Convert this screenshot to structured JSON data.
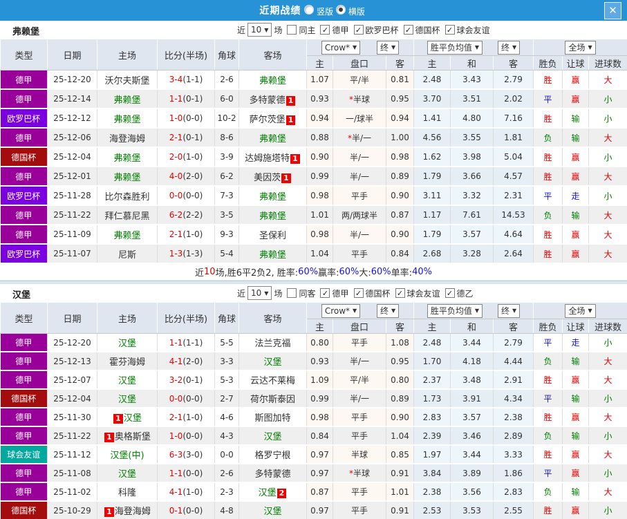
{
  "title_bar": {
    "title": "近期战绩",
    "radios": [
      {
        "label": "竖版",
        "selected": false
      },
      {
        "label": "横版",
        "selected": true
      }
    ],
    "close_icon": "✕"
  },
  "icons": {
    "check": "✓",
    "dropdown_arrow": "▼"
  },
  "colors": {
    "titlebar": "#2793D6",
    "type_colors": {
      "德甲": "#990099",
      "欧罗巴杯": "#7A00E0",
      "德国杯": "#A30D0D",
      "球会友谊": "#00A89E"
    },
    "result_colors": {
      "胜": "#E60000",
      "平": "#1414E6",
      "负": "#008000",
      "赢": "#E60000",
      "走": "#1414E6",
      "输": "#008000",
      "大": "#E60000",
      "小": "#008000"
    }
  },
  "table_headers": {
    "left": [
      "类型",
      "日期",
      "主场",
      "比分(半场)",
      "角球",
      "客场"
    ],
    "subs": [
      "主",
      "盘口",
      "客",
      "主",
      "和",
      "客",
      "胜负",
      "让球",
      "进球数"
    ],
    "control_groups": [
      [
        "Crow*",
        "终"
      ],
      [
        "胜平负均值",
        "终"
      ],
      [
        "全场"
      ]
    ]
  },
  "sections": [
    {
      "team": "弗赖堡",
      "filter": {
        "prefix": "近",
        "count": "10",
        "suffix": "场",
        "same": {
          "label": "同主",
          "checked": false
        },
        "leagues": [
          {
            "label": "德甲",
            "checked": true
          },
          {
            "label": "欧罗巴杯",
            "checked": true
          },
          {
            "label": "德国杯",
            "checked": true
          },
          {
            "label": "球会友谊",
            "checked": true
          }
        ]
      },
      "rows": [
        {
          "type": "德甲",
          "date": "25-12-20",
          "home": {
            "n": "沃尔夫斯堡"
          },
          "score": "3-4",
          "half": "1-1",
          "corner": "2-6",
          "away": {
            "n": "弗赖堡",
            "g": true
          },
          "o1": "1.07",
          "hcap": "平/半",
          "o2": "0.81",
          "avg": [
            "2.48",
            "3.43",
            "2.79"
          ],
          "res": [
            "胜",
            "赢",
            "大"
          ]
        },
        {
          "type": "德甲",
          "date": "25-12-14",
          "home": {
            "n": "弗赖堡",
            "g": true
          },
          "score": "1-1",
          "half": "0-1",
          "corner": "6-0",
          "away": {
            "n": "多特蒙德",
            "b": "1",
            "bp": "after"
          },
          "o1": "0.93",
          "hcap": "*半球",
          "o2": "0.95",
          "avg": [
            "3.70",
            "3.51",
            "2.02"
          ],
          "res": [
            "平",
            "赢",
            "小"
          ]
        },
        {
          "type": "欧罗巴杯",
          "date": "25-12-12",
          "home": {
            "n": "弗赖堡",
            "g": true
          },
          "score": "1-0",
          "half": "0-0",
          "corner": "10-2",
          "away": {
            "n": "萨尔茨堡",
            "b": "1",
            "bp": "after"
          },
          "o1": "0.94",
          "hcap": "一/球半",
          "o2": "0.94",
          "avg": [
            "1.41",
            "4.80",
            "7.16"
          ],
          "res": [
            "胜",
            "输",
            "小"
          ]
        },
        {
          "type": "德甲",
          "date": "25-12-06",
          "home": {
            "n": "海登海姆"
          },
          "score": "2-1",
          "half": "0-1",
          "corner": "8-6",
          "away": {
            "n": "弗赖堡",
            "g": true
          },
          "o1": "0.88",
          "hcap": "*半/一",
          "o2": "1.00",
          "avg": [
            "4.56",
            "3.55",
            "1.81"
          ],
          "res": [
            "负",
            "输",
            "大"
          ]
        },
        {
          "type": "德国杯",
          "date": "25-12-04",
          "home": {
            "n": "弗赖堡",
            "g": true
          },
          "score": "2-0",
          "half": "1-0",
          "corner": "3-9",
          "away": {
            "n": "达姆施塔特",
            "b": "1",
            "bp": "after"
          },
          "o1": "0.90",
          "hcap": "半/一",
          "o2": "0.98",
          "avg": [
            "1.62",
            "3.98",
            "5.04"
          ],
          "res": [
            "胜",
            "赢",
            "小"
          ]
        },
        {
          "type": "德甲",
          "date": "25-12-01",
          "home": {
            "n": "弗赖堡",
            "g": true
          },
          "score": "4-0",
          "half": "2-0",
          "corner": "6-2",
          "away": {
            "n": "美因茨",
            "b": "1",
            "bp": "after"
          },
          "o1": "0.99",
          "hcap": "半/一",
          "o2": "0.89",
          "avg": [
            "1.79",
            "3.66",
            "4.57"
          ],
          "res": [
            "胜",
            "赢",
            "大"
          ]
        },
        {
          "type": "欧罗巴杯",
          "date": "25-11-28",
          "home": {
            "n": "比尔森胜利"
          },
          "score": "0-0",
          "half": "0-0",
          "corner": "7-3",
          "away": {
            "n": "弗赖堡",
            "g": true
          },
          "o1": "0.98",
          "hcap": "平手",
          "o2": "0.90",
          "avg": [
            "3.11",
            "3.32",
            "2.31"
          ],
          "res": [
            "平",
            "走",
            "小"
          ]
        },
        {
          "type": "德甲",
          "date": "25-11-22",
          "home": {
            "n": "拜仁慕尼黑"
          },
          "score": "6-2",
          "half": "2-2",
          "corner": "3-5",
          "away": {
            "n": "弗赖堡",
            "g": true
          },
          "o1": "1.01",
          "hcap": "两/两球半",
          "o2": "0.87",
          "avg": [
            "1.17",
            "7.61",
            "14.53"
          ],
          "res": [
            "负",
            "输",
            "大"
          ]
        },
        {
          "type": "德甲",
          "date": "25-11-09",
          "home": {
            "n": "弗赖堡",
            "g": true
          },
          "score": "2-1",
          "half": "1-0",
          "corner": "9-3",
          "away": {
            "n": "圣保利"
          },
          "o1": "0.98",
          "hcap": "半/一",
          "o2": "0.90",
          "avg": [
            "1.79",
            "3.57",
            "4.64"
          ],
          "res": [
            "胜",
            "赢",
            "大"
          ]
        },
        {
          "type": "欧罗巴杯",
          "date": "25-11-07",
          "home": {
            "n": "尼斯"
          },
          "score": "1-3",
          "half": "1-3",
          "corner": "5-4",
          "away": {
            "n": "弗赖堡",
            "g": true
          },
          "o1": "1.04",
          "hcap": "平手",
          "o2": "0.84",
          "avg": [
            "2.68",
            "3.28",
            "2.64"
          ],
          "res": [
            "胜",
            "赢",
            "大"
          ]
        }
      ],
      "summary": [
        {
          "t": "近",
          "c": "k"
        },
        {
          "t": "10",
          "c": "r"
        },
        {
          "t": "场,胜6平2负2, 胜率:",
          "c": "k"
        },
        {
          "t": "60%",
          "c": "b"
        },
        {
          "t": " 赢率:",
          "c": "k"
        },
        {
          "t": "60%",
          "c": "b"
        },
        {
          "t": " 大:",
          "c": "k"
        },
        {
          "t": "60%",
          "c": "b"
        },
        {
          "t": " 单率:",
          "c": "k"
        },
        {
          "t": "40%",
          "c": "b"
        }
      ]
    },
    {
      "team": "汉堡",
      "filter": {
        "prefix": "近",
        "count": "10",
        "suffix": "场",
        "same": {
          "label": "同客",
          "checked": false
        },
        "leagues": [
          {
            "label": "德甲",
            "checked": true
          },
          {
            "label": "德国杯",
            "checked": true
          },
          {
            "label": "球会友谊",
            "checked": true
          },
          {
            "label": "德乙",
            "checked": true
          }
        ]
      },
      "rows": [
        {
          "type": "德甲",
          "date": "25-12-20",
          "home": {
            "n": "汉堡",
            "g": true
          },
          "score": "1-1",
          "half": "1-1",
          "corner": "5-5",
          "away": {
            "n": "法兰克福"
          },
          "o1": "0.80",
          "hcap": "平手",
          "o2": "1.08",
          "avg": [
            "2.48",
            "3.44",
            "2.79"
          ],
          "res": [
            "平",
            "走",
            "小"
          ]
        },
        {
          "type": "德甲",
          "date": "25-12-13",
          "home": {
            "n": "霍芬海姆"
          },
          "score": "4-1",
          "half": "2-0",
          "corner": "3-3",
          "away": {
            "n": "汉堡",
            "g": true
          },
          "o1": "0.93",
          "hcap": "半/一",
          "o2": "0.95",
          "avg": [
            "1.70",
            "4.18",
            "4.44"
          ],
          "res": [
            "负",
            "输",
            "大"
          ]
        },
        {
          "type": "德甲",
          "date": "25-12-07",
          "home": {
            "n": "汉堡",
            "g": true
          },
          "score": "3-2",
          "half": "0-1",
          "corner": "5-3",
          "away": {
            "n": "云达不莱梅"
          },
          "o1": "1.09",
          "hcap": "平/半",
          "o2": "0.80",
          "avg": [
            "2.37",
            "3.48",
            "2.91"
          ],
          "res": [
            "胜",
            "赢",
            "大"
          ]
        },
        {
          "type": "德国杯",
          "date": "25-12-04",
          "home": {
            "n": "汉堡",
            "g": true
          },
          "score": "0-0",
          "half": "0-0",
          "corner": "2-7",
          "away": {
            "n": "荷尔斯泰因"
          },
          "o1": "0.99",
          "hcap": "半/一",
          "o2": "0.89",
          "avg": [
            "1.73",
            "3.91",
            "4.34"
          ],
          "res": [
            "平",
            "输",
            "小"
          ]
        },
        {
          "type": "德甲",
          "date": "25-11-30",
          "home": {
            "n": "汉堡",
            "g": true,
            "b": "1",
            "bp": "before"
          },
          "score": "2-1",
          "half": "1-0",
          "corner": "4-6",
          "away": {
            "n": "斯图加特"
          },
          "o1": "0.98",
          "hcap": "平手",
          "o2": "0.90",
          "avg": [
            "2.83",
            "3.57",
            "2.38"
          ],
          "res": [
            "胜",
            "赢",
            "大"
          ]
        },
        {
          "type": "德甲",
          "date": "25-11-22",
          "home": {
            "n": "奥格斯堡",
            "b": "1",
            "bp": "before"
          },
          "score": "1-0",
          "half": "0-0",
          "corner": "4-3",
          "away": {
            "n": "汉堡",
            "g": true
          },
          "o1": "0.84",
          "hcap": "平手",
          "o2": "1.04",
          "avg": [
            "2.39",
            "3.46",
            "2.89"
          ],
          "res": [
            "负",
            "输",
            "小"
          ]
        },
        {
          "type": "球会友谊",
          "date": "25-11-12",
          "home": {
            "n": "汉堡(中)",
            "g": true
          },
          "score": "6-3",
          "half": "3-0",
          "corner": "0-0",
          "away": {
            "n": "格罗宁根"
          },
          "o1": "0.97",
          "hcap": "半球",
          "o2": "0.85",
          "avg": [
            "1.97",
            "3.44",
            "3.33"
          ],
          "res": [
            "胜",
            "赢",
            "大"
          ]
        },
        {
          "type": "德甲",
          "date": "25-11-08",
          "home": {
            "n": "汉堡",
            "g": true
          },
          "score": "1-1",
          "half": "0-0",
          "corner": "2-6",
          "away": {
            "n": "多特蒙德"
          },
          "o1": "0.97",
          "hcap": "*半球",
          "o2": "0.91",
          "avg": [
            "3.84",
            "3.89",
            "1.86"
          ],
          "res": [
            "平",
            "赢",
            "小"
          ]
        },
        {
          "type": "德甲",
          "date": "25-11-02",
          "home": {
            "n": "科隆"
          },
          "score": "4-1",
          "half": "1-0",
          "corner": "2-3",
          "away": {
            "n": "汉堡",
            "g": true,
            "b": "2",
            "bp": "after"
          },
          "o1": "0.87",
          "hcap": "平手",
          "o2": "1.01",
          "avg": [
            "2.38",
            "3.56",
            "2.83"
          ],
          "res": [
            "负",
            "输",
            "大"
          ]
        },
        {
          "type": "德国杯",
          "date": "25-10-29",
          "home": {
            "n": "海登海姆",
            "b": "1",
            "bp": "before"
          },
          "score": "0-1",
          "half": "0-0",
          "corner": "4-8",
          "away": {
            "n": "汉堡",
            "g": true
          },
          "o1": "0.97",
          "hcap": "平手",
          "o2": "0.91",
          "avg": [
            "2.53",
            "3.53",
            "2.55"
          ],
          "res": [
            "胜",
            "赢",
            "小"
          ]
        }
      ],
      "summary": null
    }
  ]
}
